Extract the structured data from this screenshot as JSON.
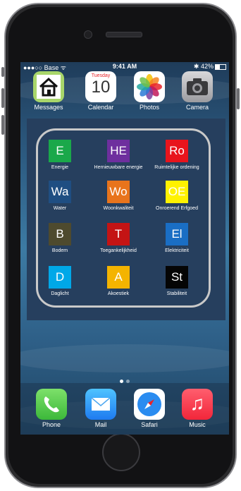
{
  "status": {
    "carrier": "●●●○○ Base",
    "wifi": "ᯤ",
    "time": "9:41 AM",
    "bluetooth": "✱",
    "battery_text": "42%",
    "battery_level": 0.42
  },
  "apps": [
    {
      "label": "Messages",
      "icon": "home-icon",
      "bg": "#a8d66a"
    },
    {
      "label": "Calendar",
      "day": "Tuesday",
      "date": "10",
      "icon": "calendar-icon"
    },
    {
      "label": "Photos",
      "icon": "photos-icon"
    },
    {
      "label": "Camera",
      "icon": "camera-icon"
    }
  ],
  "tiles": [
    {
      "code": "E",
      "label": "Energie",
      "color": "#1aa84a"
    },
    {
      "code": "HE",
      "label": "Hernieuwbare energie",
      "color": "#6e2f9e"
    },
    {
      "code": "Ro",
      "label": "Ruimtelijke ordening",
      "color": "#e8141c"
    },
    {
      "code": "Wa",
      "label": "Water",
      "color": "#1f4e82"
    },
    {
      "code": "Wo",
      "label": "Woonkwaliteit",
      "color": "#e8741c"
    },
    {
      "code": "OE",
      "label": "Onroerend Erfgoed",
      "color": "#fff200"
    },
    {
      "code": "B",
      "label": "Bodem",
      "color": "#4e4a2e"
    },
    {
      "code": "T",
      "label": "Toegankelijkheid",
      "color": "#c41414"
    },
    {
      "code": "El",
      "label": "Elektriciteit",
      "color": "#1a6ec4"
    },
    {
      "code": "D",
      "label": "Daglicht",
      "color": "#00a8e8"
    },
    {
      "code": "A",
      "label": "Akoestiek",
      "color": "#f4b400"
    },
    {
      "code": "St",
      "label": "Stabiliteit",
      "color": "#050505"
    }
  ],
  "dock": [
    {
      "label": "Phone",
      "icon": "phone-icon"
    },
    {
      "label": "Mail",
      "icon": "mail-icon"
    },
    {
      "label": "Safari",
      "icon": "safari-icon"
    },
    {
      "label": "Music",
      "icon": "music-icon"
    }
  ]
}
